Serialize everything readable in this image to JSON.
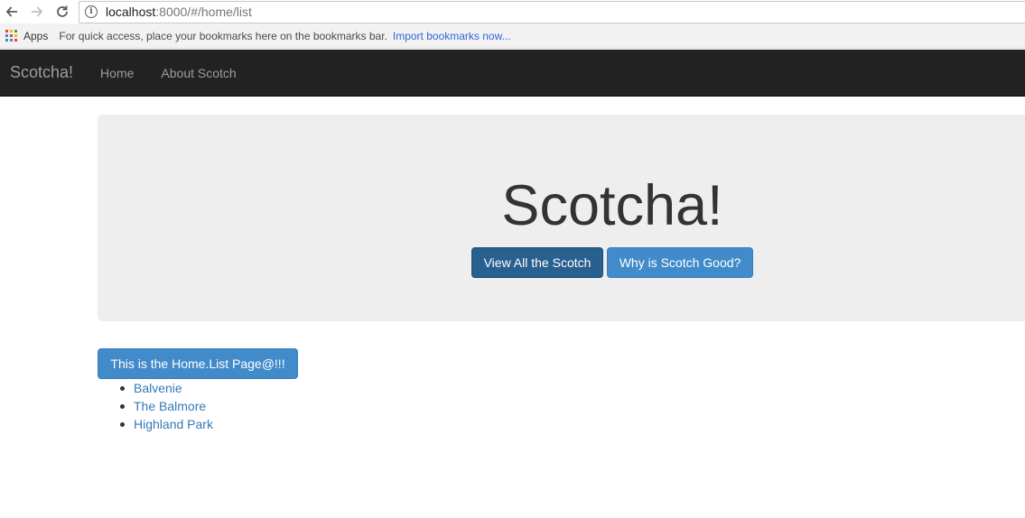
{
  "browser": {
    "url_host": "localhost",
    "url_rest": ":8000/#/home/list",
    "apps_label": "Apps",
    "bookmarks_hint": "For quick access, place your bookmarks here on the bookmarks bar.",
    "import_link": "Import bookmarks now..."
  },
  "navbar": {
    "brand": "Scotcha!",
    "links": [
      "Home",
      "About Scotch"
    ]
  },
  "jumbotron": {
    "title": "Scotcha!",
    "buttons": [
      "View All the Scotch",
      "Why is Scotch Good?"
    ]
  },
  "list_page": {
    "button_label": "This is the Home.List Page@!!!",
    "items": [
      "Balvenie",
      "The Balmore",
      "Highland Park"
    ]
  },
  "colors": {
    "navbar_bg": "#222222",
    "jumbotron_bg": "#eeeeee",
    "primary": "#428bca",
    "primary_active": "#286090",
    "link": "#337ab7"
  },
  "icons": [
    "back-arrow-icon",
    "forward-arrow-icon",
    "reload-icon",
    "info-icon",
    "apps-grid-icon"
  ]
}
